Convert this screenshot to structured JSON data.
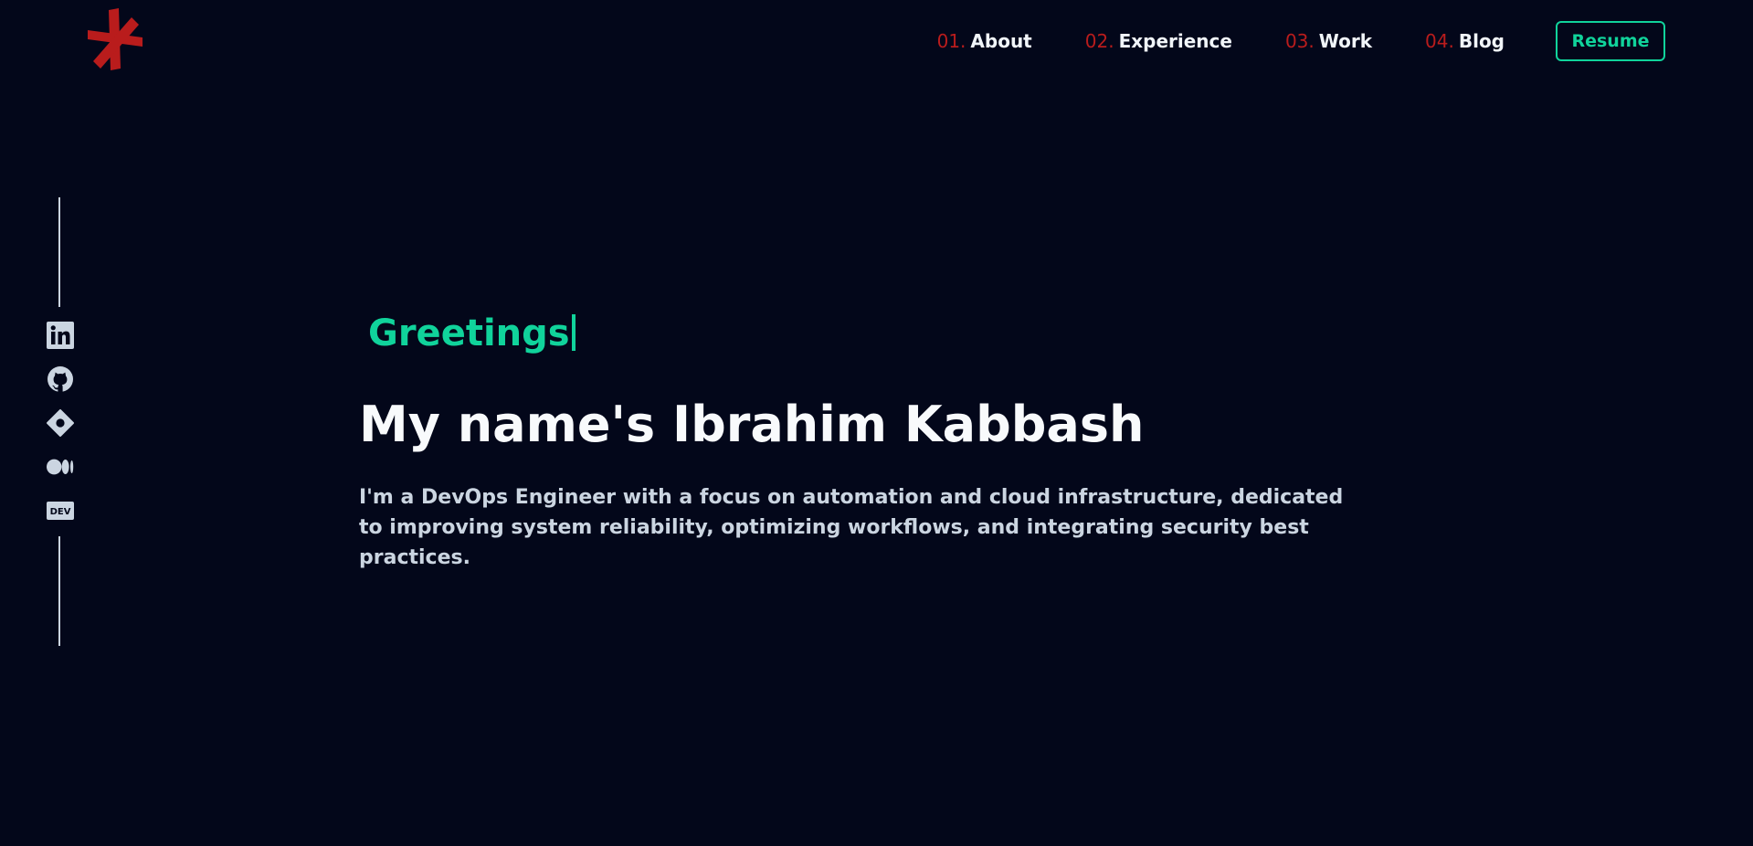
{
  "header": {
    "logo_icon": "asterisk-logo-icon",
    "logo_color": "#b91c1c",
    "nav": [
      {
        "number": "01.",
        "label": "About"
      },
      {
        "number": "02.",
        "label": "Experience"
      },
      {
        "number": "03.",
        "label": "Work"
      },
      {
        "number": "04.",
        "label": "Blog"
      }
    ],
    "resume_label": "Resume"
  },
  "social": [
    {
      "icon": "linkedin-icon"
    },
    {
      "icon": "github-icon"
    },
    {
      "icon": "diamond-icon"
    },
    {
      "icon": "medium-icon"
    },
    {
      "icon": "dev-icon",
      "text": "DEV"
    }
  ],
  "hero": {
    "greeting": "Greetings",
    "name": "My name's Ibrahim Kabbash",
    "tagline": "I'm a DevOps Engineer with a focus on automation and cloud infrastructure, dedicated to improving system reliability, optimizing workflows, and integrating security best practices."
  },
  "colors": {
    "background": "#03071a",
    "accent": "#10d39b",
    "brand_red": "#b91c1c",
    "text": "#f8fafc",
    "muted_text": "#cbd5e1"
  }
}
